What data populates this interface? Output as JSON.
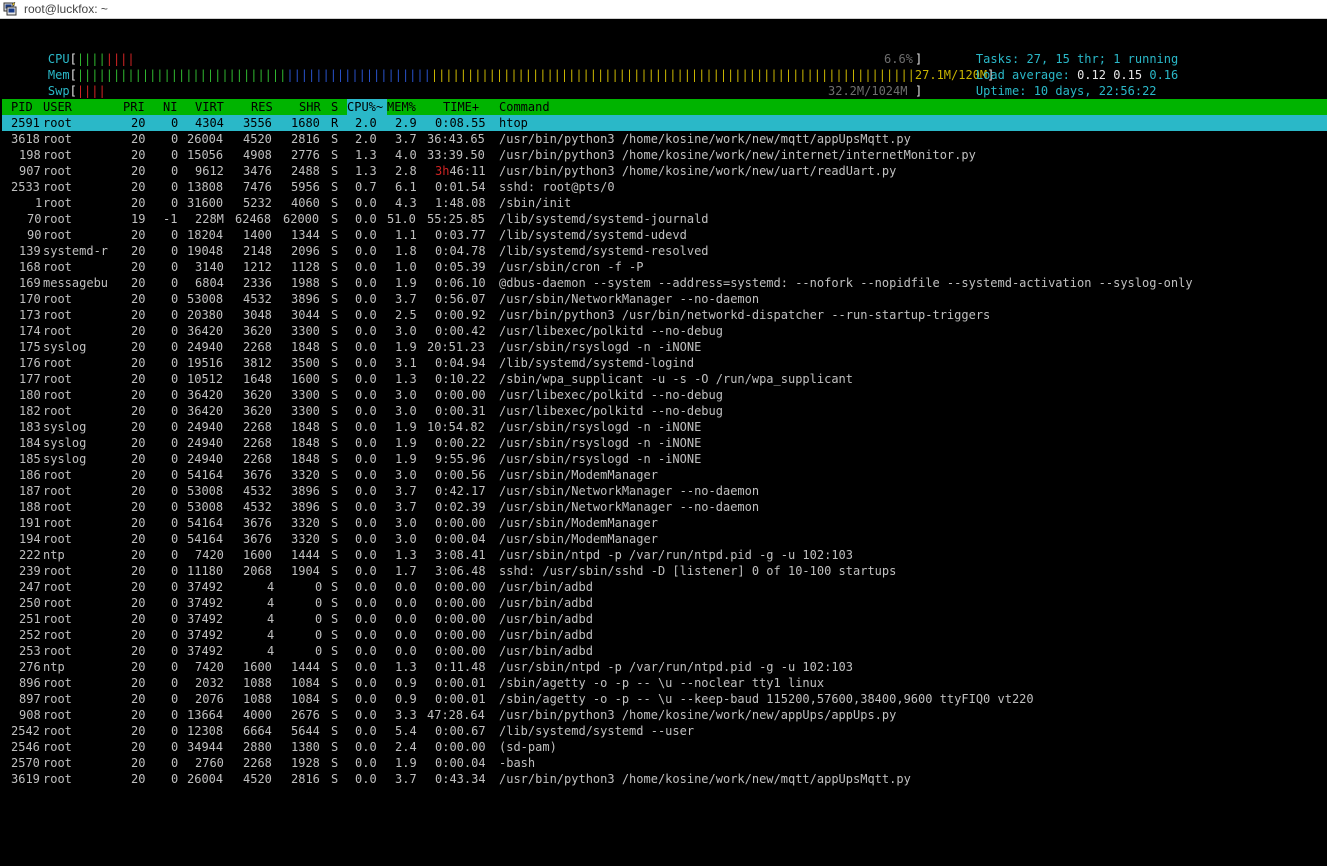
{
  "window": {
    "title": "root@luckfox: ~"
  },
  "meters": {
    "cpu": {
      "label": "CPU",
      "value": "6.6%",
      "percent": 6.6
    },
    "mem": {
      "label": "Mem",
      "value": "27.1M/120M"
    },
    "swp": {
      "label": "Swp",
      "value": "32.2M/1024M"
    }
  },
  "summary": {
    "tasks_label": "Tasks: ",
    "tasks_count": "27",
    "sep1": ", ",
    "threads": "15",
    "thr_label": " thr; ",
    "running": "1",
    "running_label": " running",
    "load_label": "Load average: ",
    "load1": "0.12",
    "load5": "0.15",
    "load15": "0.16",
    "uptime_label": "Uptime: ",
    "uptime": "10 days, 22:56:22"
  },
  "header": {
    "pid": "PID",
    "user": "USER",
    "pri": "PRI",
    "ni": "NI",
    "virt": "VIRT",
    "res": "RES",
    "shr": "SHR",
    "s": "S",
    "cpu": "CPU%",
    "sort_arrow": "~",
    "mem": "MEM%",
    "time": "TIME+",
    "command": "Command"
  },
  "processes": [
    {
      "pid": "2591",
      "user": "root",
      "pri": "20",
      "ni": "0",
      "virt": "4304",
      "res": "3556",
      "shr": "1680",
      "s": "R",
      "cpu": "2.0",
      "mem": "2.9",
      "time": "0:08.55",
      "command": "htop",
      "selected": true
    },
    {
      "pid": "3618",
      "user": "root",
      "pri": "20",
      "ni": "0",
      "virt": "26004",
      "res": "4520",
      "shr": "2816",
      "s": "S",
      "cpu": "2.0",
      "mem": "3.7",
      "time": "36:43.65",
      "command": "/usr/bin/python3 /home/kosine/work/new/mqtt/appUpsMqtt.py"
    },
    {
      "pid": "198",
      "user": "root",
      "pri": "20",
      "ni": "0",
      "virt": "15056",
      "res": "4908",
      "shr": "2776",
      "s": "S",
      "cpu": "1.3",
      "mem": "4.0",
      "time": "33:39.50",
      "command": "/usr/bin/python3 /home/kosine/work/new/internet/internetMonitor.py"
    },
    {
      "pid": "907",
      "user": "root",
      "pri": "20",
      "ni": "0",
      "virt": "9612",
      "res": "3476",
      "shr": "2488",
      "s": "S",
      "cpu": "1.3",
      "mem": "2.8",
      "time": "3h46:11",
      "command": "/usr/bin/python3 /home/kosine/work/new/uart/readUart.py"
    },
    {
      "pid": "2533",
      "user": "root",
      "pri": "20",
      "ni": "0",
      "virt": "13808",
      "res": "7476",
      "shr": "5956",
      "s": "S",
      "cpu": "0.7",
      "mem": "6.1",
      "time": "0:01.54",
      "command": "sshd: root@pts/0"
    },
    {
      "pid": "1",
      "user": "root",
      "pri": "20",
      "ni": "0",
      "virt": "31600",
      "res": "5232",
      "shr": "4060",
      "s": "S",
      "cpu": "0.0",
      "mem": "4.3",
      "time": "1:48.08",
      "command": "/sbin/init"
    },
    {
      "pid": "70",
      "user": "root",
      "pri": "19",
      "ni": "-1",
      "virt": "228M",
      "res": "62468",
      "shr": "62000",
      "s": "S",
      "cpu": "0.0",
      "mem": "51.0",
      "time": "55:25.85",
      "command": "/lib/systemd/systemd-journald"
    },
    {
      "pid": "90",
      "user": "root",
      "pri": "20",
      "ni": "0",
      "virt": "18204",
      "res": "1400",
      "shr": "1344",
      "s": "S",
      "cpu": "0.0",
      "mem": "1.1",
      "time": "0:03.77",
      "command": "/lib/systemd/systemd-udevd"
    },
    {
      "pid": "139",
      "user": "systemd-r",
      "pri": "20",
      "ni": "0",
      "virt": "19048",
      "res": "2148",
      "shr": "2096",
      "s": "S",
      "cpu": "0.0",
      "mem": "1.8",
      "time": "0:04.78",
      "command": "/lib/systemd/systemd-resolved"
    },
    {
      "pid": "168",
      "user": "root",
      "pri": "20",
      "ni": "0",
      "virt": "3140",
      "res": "1212",
      "shr": "1128",
      "s": "S",
      "cpu": "0.0",
      "mem": "1.0",
      "time": "0:05.39",
      "command": "/usr/sbin/cron -f -P"
    },
    {
      "pid": "169",
      "user": "messagebu",
      "pri": "20",
      "ni": "0",
      "virt": "6804",
      "res": "2336",
      "shr": "1988",
      "s": "S",
      "cpu": "0.0",
      "mem": "1.9",
      "time": "0:06.10",
      "command": "@dbus-daemon --system --address=systemd: --nofork --nopidfile --systemd-activation --syslog-only"
    },
    {
      "pid": "170",
      "user": "root",
      "pri": "20",
      "ni": "0",
      "virt": "53008",
      "res": "4532",
      "shr": "3896",
      "s": "S",
      "cpu": "0.0",
      "mem": "3.7",
      "time": "0:56.07",
      "command": "/usr/sbin/NetworkManager --no-daemon"
    },
    {
      "pid": "173",
      "user": "root",
      "pri": "20",
      "ni": "0",
      "virt": "20380",
      "res": "3048",
      "shr": "3044",
      "s": "S",
      "cpu": "0.0",
      "mem": "2.5",
      "time": "0:00.92",
      "command": "/usr/bin/python3 /usr/bin/networkd-dispatcher --run-startup-triggers"
    },
    {
      "pid": "174",
      "user": "root",
      "pri": "20",
      "ni": "0",
      "virt": "36420",
      "res": "3620",
      "shr": "3300",
      "s": "S",
      "cpu": "0.0",
      "mem": "3.0",
      "time": "0:00.42",
      "command": "/usr/libexec/polkitd --no-debug"
    },
    {
      "pid": "175",
      "user": "syslog",
      "pri": "20",
      "ni": "0",
      "virt": "24940",
      "res": "2268",
      "shr": "1848",
      "s": "S",
      "cpu": "0.0",
      "mem": "1.9",
      "time": "20:51.23",
      "command": "/usr/sbin/rsyslogd -n -iNONE"
    },
    {
      "pid": "176",
      "user": "root",
      "pri": "20",
      "ni": "0",
      "virt": "19516",
      "res": "3812",
      "shr": "3500",
      "s": "S",
      "cpu": "0.0",
      "mem": "3.1",
      "time": "0:04.94",
      "command": "/lib/systemd/systemd-logind"
    },
    {
      "pid": "177",
      "user": "root",
      "pri": "20",
      "ni": "0",
      "virt": "10512",
      "res": "1648",
      "shr": "1600",
      "s": "S",
      "cpu": "0.0",
      "mem": "1.3",
      "time": "0:10.22",
      "command": "/sbin/wpa_supplicant -u -s -O /run/wpa_supplicant"
    },
    {
      "pid": "180",
      "user": "root",
      "pri": "20",
      "ni": "0",
      "virt": "36420",
      "res": "3620",
      "shr": "3300",
      "s": "S",
      "cpu": "0.0",
      "mem": "3.0",
      "time": "0:00.00",
      "command": "/usr/libexec/polkitd --no-debug",
      "thread": true
    },
    {
      "pid": "182",
      "user": "root",
      "pri": "20",
      "ni": "0",
      "virt": "36420",
      "res": "3620",
      "shr": "3300",
      "s": "S",
      "cpu": "0.0",
      "mem": "3.0",
      "time": "0:00.31",
      "command": "/usr/libexec/polkitd --no-debug",
      "thread": true
    },
    {
      "pid": "183",
      "user": "syslog",
      "pri": "20",
      "ni": "0",
      "virt": "24940",
      "res": "2268",
      "shr": "1848",
      "s": "S",
      "cpu": "0.0",
      "mem": "1.9",
      "time": "10:54.82",
      "command": "/usr/sbin/rsyslogd -n -iNONE",
      "thread": true
    },
    {
      "pid": "184",
      "user": "syslog",
      "pri": "20",
      "ni": "0",
      "virt": "24940",
      "res": "2268",
      "shr": "1848",
      "s": "S",
      "cpu": "0.0",
      "mem": "1.9",
      "time": "0:00.22",
      "command": "/usr/sbin/rsyslogd -n -iNONE",
      "thread": true
    },
    {
      "pid": "185",
      "user": "syslog",
      "pri": "20",
      "ni": "0",
      "virt": "24940",
      "res": "2268",
      "shr": "1848",
      "s": "S",
      "cpu": "0.0",
      "mem": "1.9",
      "time": "9:55.96",
      "command": "/usr/sbin/rsyslogd -n -iNONE",
      "thread": true
    },
    {
      "pid": "186",
      "user": "root",
      "pri": "20",
      "ni": "0",
      "virt": "54164",
      "res": "3676",
      "shr": "3320",
      "s": "S",
      "cpu": "0.0",
      "mem": "3.0",
      "time": "0:00.56",
      "command": "/usr/sbin/ModemManager"
    },
    {
      "pid": "187",
      "user": "root",
      "pri": "20",
      "ni": "0",
      "virt": "53008",
      "res": "4532",
      "shr": "3896",
      "s": "S",
      "cpu": "0.0",
      "mem": "3.7",
      "time": "0:42.17",
      "command": "/usr/sbin/NetworkManager --no-daemon",
      "thread": true
    },
    {
      "pid": "188",
      "user": "root",
      "pri": "20",
      "ni": "0",
      "virt": "53008",
      "res": "4532",
      "shr": "3896",
      "s": "S",
      "cpu": "0.0",
      "mem": "3.7",
      "time": "0:02.39",
      "command": "/usr/sbin/NetworkManager --no-daemon",
      "thread": true
    },
    {
      "pid": "191",
      "user": "root",
      "pri": "20",
      "ni": "0",
      "virt": "54164",
      "res": "3676",
      "shr": "3320",
      "s": "S",
      "cpu": "0.0",
      "mem": "3.0",
      "time": "0:00.00",
      "command": "/usr/sbin/ModemManager",
      "thread": true
    },
    {
      "pid": "194",
      "user": "root",
      "pri": "20",
      "ni": "0",
      "virt": "54164",
      "res": "3676",
      "shr": "3320",
      "s": "S",
      "cpu": "0.0",
      "mem": "3.0",
      "time": "0:00.04",
      "command": "/usr/sbin/ModemManager",
      "thread": true
    },
    {
      "pid": "222",
      "user": "ntp",
      "pri": "20",
      "ni": "0",
      "virt": "7420",
      "res": "1600",
      "shr": "1444",
      "s": "S",
      "cpu": "0.0",
      "mem": "1.3",
      "time": "3:08.41",
      "command": "/usr/sbin/ntpd -p /var/run/ntpd.pid -g -u 102:103"
    },
    {
      "pid": "239",
      "user": "root",
      "pri": "20",
      "ni": "0",
      "virt": "11180",
      "res": "2068",
      "shr": "1904",
      "s": "S",
      "cpu": "0.0",
      "mem": "1.7",
      "time": "3:06.48",
      "command": "sshd: /usr/sbin/sshd -D [listener] 0 of 10-100 startups"
    },
    {
      "pid": "247",
      "user": "root",
      "pri": "20",
      "ni": "0",
      "virt": "37492",
      "res": "4",
      "shr": "0",
      "s": "S",
      "cpu": "0.0",
      "mem": "0.0",
      "time": "0:00.00",
      "command": "/usr/bin/adbd"
    },
    {
      "pid": "250",
      "user": "root",
      "pri": "20",
      "ni": "0",
      "virt": "37492",
      "res": "4",
      "shr": "0",
      "s": "S",
      "cpu": "0.0",
      "mem": "0.0",
      "time": "0:00.00",
      "command": "/usr/bin/adbd",
      "thread": true
    },
    {
      "pid": "251",
      "user": "root",
      "pri": "20",
      "ni": "0",
      "virt": "37492",
      "res": "4",
      "shr": "0",
      "s": "S",
      "cpu": "0.0",
      "mem": "0.0",
      "time": "0:00.00",
      "command": "/usr/bin/adbd",
      "thread": true
    },
    {
      "pid": "252",
      "user": "root",
      "pri": "20",
      "ni": "0",
      "virt": "37492",
      "res": "4",
      "shr": "0",
      "s": "S",
      "cpu": "0.0",
      "mem": "0.0",
      "time": "0:00.00",
      "command": "/usr/bin/adbd",
      "thread": true
    },
    {
      "pid": "253",
      "user": "root",
      "pri": "20",
      "ni": "0",
      "virt": "37492",
      "res": "4",
      "shr": "0",
      "s": "S",
      "cpu": "0.0",
      "mem": "0.0",
      "time": "0:00.00",
      "command": "/usr/bin/adbd",
      "thread": true
    },
    {
      "pid": "276",
      "user": "ntp",
      "pri": "20",
      "ni": "0",
      "virt": "7420",
      "res": "1600",
      "shr": "1444",
      "s": "S",
      "cpu": "0.0",
      "mem": "1.3",
      "time": "0:11.48",
      "command": "/usr/sbin/ntpd -p /var/run/ntpd.pid -g -u 102:103",
      "thread": true
    },
    {
      "pid": "896",
      "user": "root",
      "pri": "20",
      "ni": "0",
      "virt": "2032",
      "res": "1088",
      "shr": "1084",
      "s": "S",
      "cpu": "0.0",
      "mem": "0.9",
      "time": "0:00.01",
      "command": "/sbin/agetty -o -p -- \\u --noclear tty1 linux"
    },
    {
      "pid": "897",
      "user": "root",
      "pri": "20",
      "ni": "0",
      "virt": "2076",
      "res": "1088",
      "shr": "1084",
      "s": "S",
      "cpu": "0.0",
      "mem": "0.9",
      "time": "0:00.01",
      "command": "/sbin/agetty -o -p -- \\u --keep-baud 115200,57600,38400,9600 ttyFIQ0 vt220"
    },
    {
      "pid": "908",
      "user": "root",
      "pri": "20",
      "ni": "0",
      "virt": "13664",
      "res": "4000",
      "shr": "2676",
      "s": "S",
      "cpu": "0.0",
      "mem": "3.3",
      "time": "47:28.64",
      "command": "/usr/bin/python3 /home/kosine/work/new/appUps/appUps.py"
    },
    {
      "pid": "2542",
      "user": "root",
      "pri": "20",
      "ni": "0",
      "virt": "12308",
      "res": "6664",
      "shr": "5644",
      "s": "S",
      "cpu": "0.0",
      "mem": "5.4",
      "time": "0:00.67",
      "command": "/lib/systemd/systemd --user"
    },
    {
      "pid": "2546",
      "user": "root",
      "pri": "20",
      "ni": "0",
      "virt": "34944",
      "res": "2880",
      "shr": "1380",
      "s": "S",
      "cpu": "0.0",
      "mem": "2.4",
      "time": "0:00.00",
      "command": "(sd-pam)"
    },
    {
      "pid": "2570",
      "user": "root",
      "pri": "20",
      "ni": "0",
      "virt": "2760",
      "res": "2268",
      "shr": "1928",
      "s": "S",
      "cpu": "0.0",
      "mem": "1.9",
      "time": "0:00.04",
      "command": "-bash"
    },
    {
      "pid": "3619",
      "user": "root",
      "pri": "20",
      "ni": "0",
      "virt": "26004",
      "res": "4520",
      "shr": "2816",
      "s": "S",
      "cpu": "0.0",
      "mem": "3.7",
      "time": "0:43.34",
      "command": "/usr/bin/python3 /home/kosine/work/new/mqtt/appUpsMqtt.py",
      "thread": true
    }
  ],
  "colors": {
    "header_bg": "#00b400",
    "selected_bg": "#2ab8c8",
    "cyan": "#2ab8c8",
    "green": "#2fb52f",
    "red": "#d02424",
    "blue": "#2850c8",
    "yellow": "#c8b400"
  }
}
